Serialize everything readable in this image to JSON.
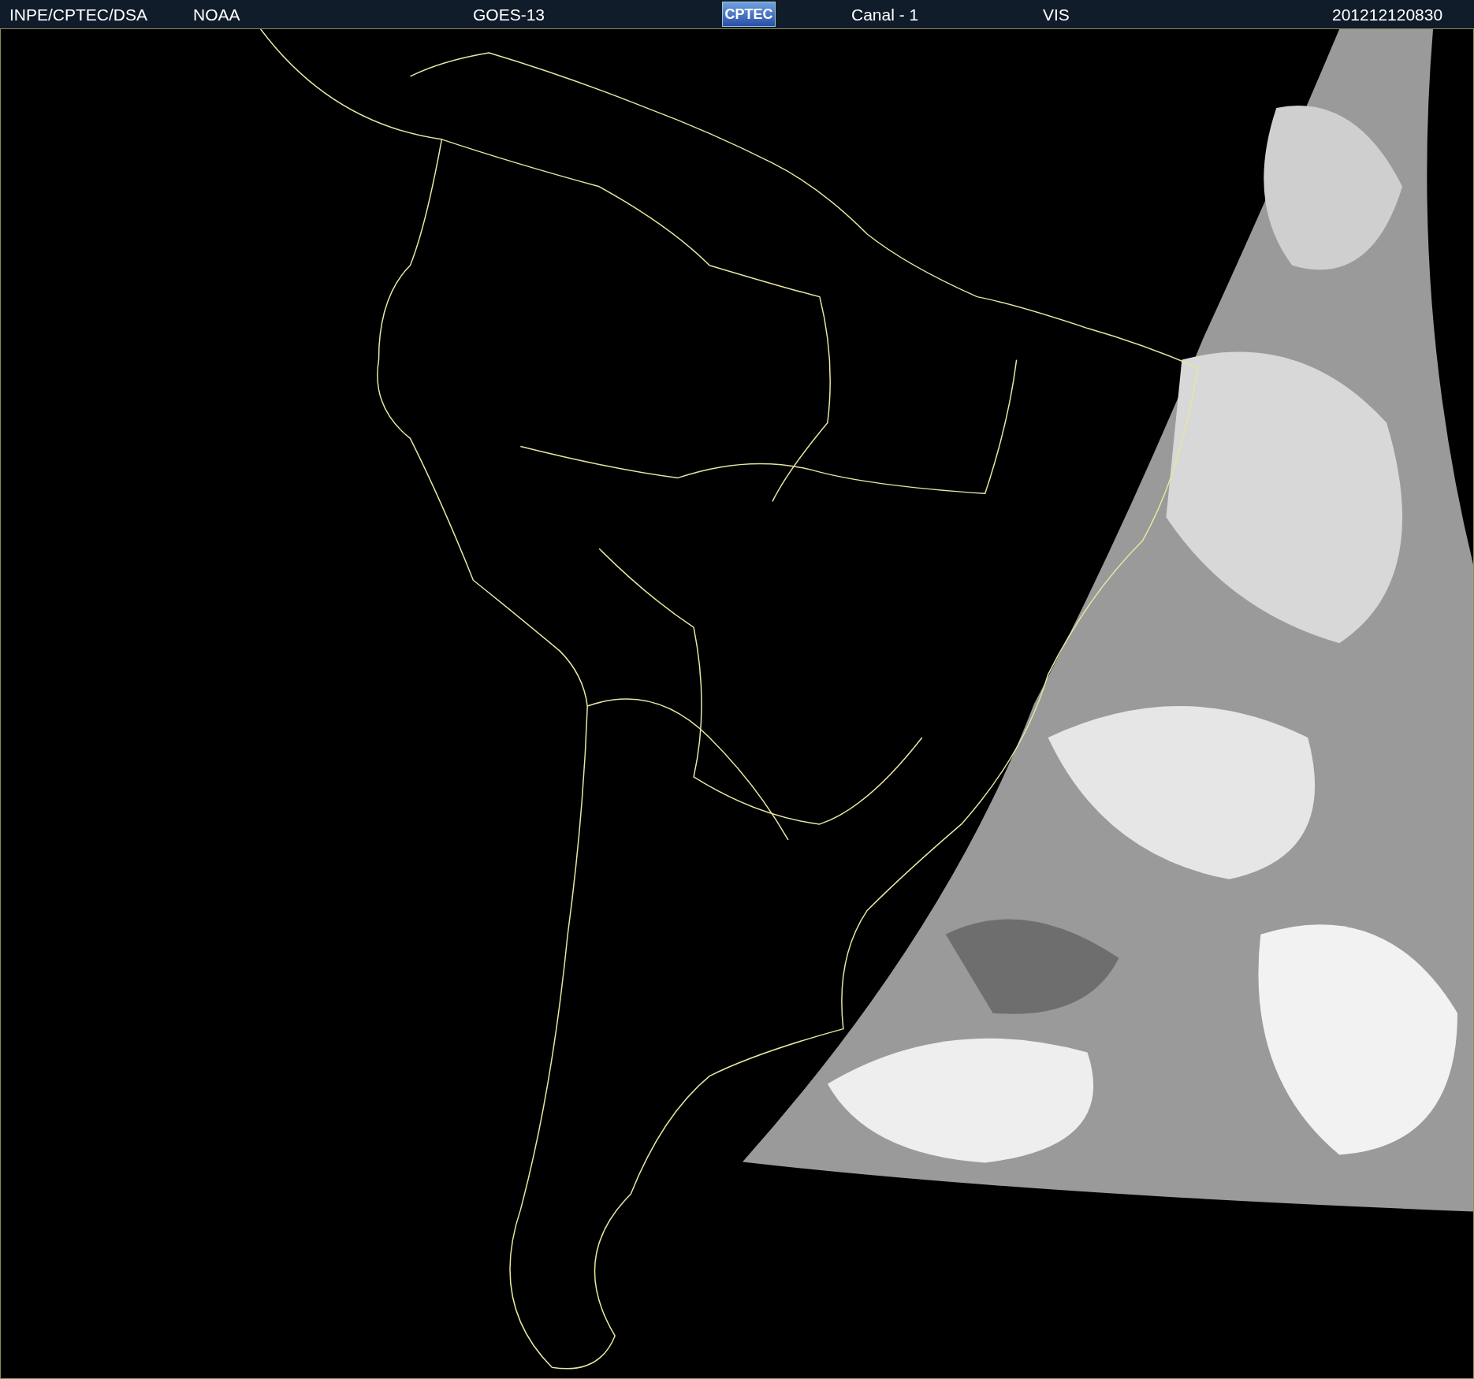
{
  "header": {
    "items": [
      {
        "kind": "text",
        "text": "INPE/CPTEC/DSA"
      },
      {
        "kind": "text",
        "text": "NOAA"
      },
      {
        "kind": "text",
        "text": "GOES-13"
      },
      {
        "kind": "logo",
        "text": "CPTEC"
      },
      {
        "kind": "text",
        "text": "Canal - 1"
      },
      {
        "kind": "text",
        "text": "VIS"
      },
      {
        "kind": "text",
        "text": "201212120830"
      }
    ]
  }
}
